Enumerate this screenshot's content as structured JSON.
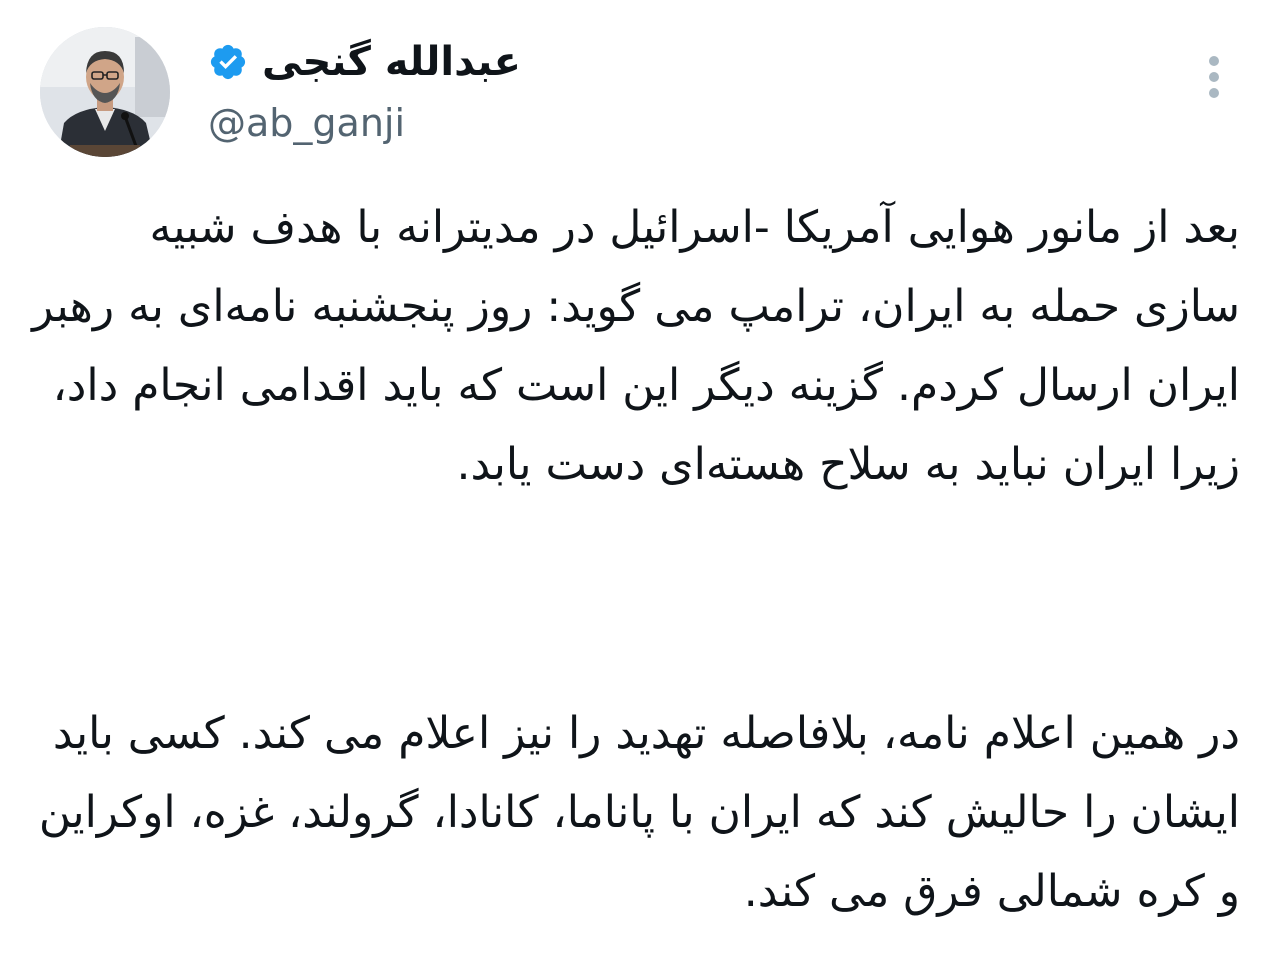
{
  "author": {
    "display_name": "عبدالله گنجی",
    "handle": "@ab_ganji",
    "verified": true,
    "avatar_icon": "profile-photo",
    "verified_color": "#1d9bf0"
  },
  "menu": {
    "icon": "more-vertical-icon"
  },
  "tweet": {
    "paragraph_1": "بعد از مانور هوایی آمریکا -اسرائیل در مدیترانه با هدف شبیه سازی حمله به ایران، ترامپ می گوید: روز پنجشنبه نامه‌ای به رهبر ایران ارسال کردم. گزینه دیگر این است که باید اقدامی انجام داد، زیرا ایران نباید به سلاح هسته‌ای دست یابد.",
    "paragraph_2": "در همین اعلام نامه، بلافاصله تهدید را نیز اعلام می کند. کسی باید ایشان را حالیش کند که ایران با پاناما، کانادا، گرولند، غزه، اوکراین و کره شمالی فرق می کند."
  }
}
